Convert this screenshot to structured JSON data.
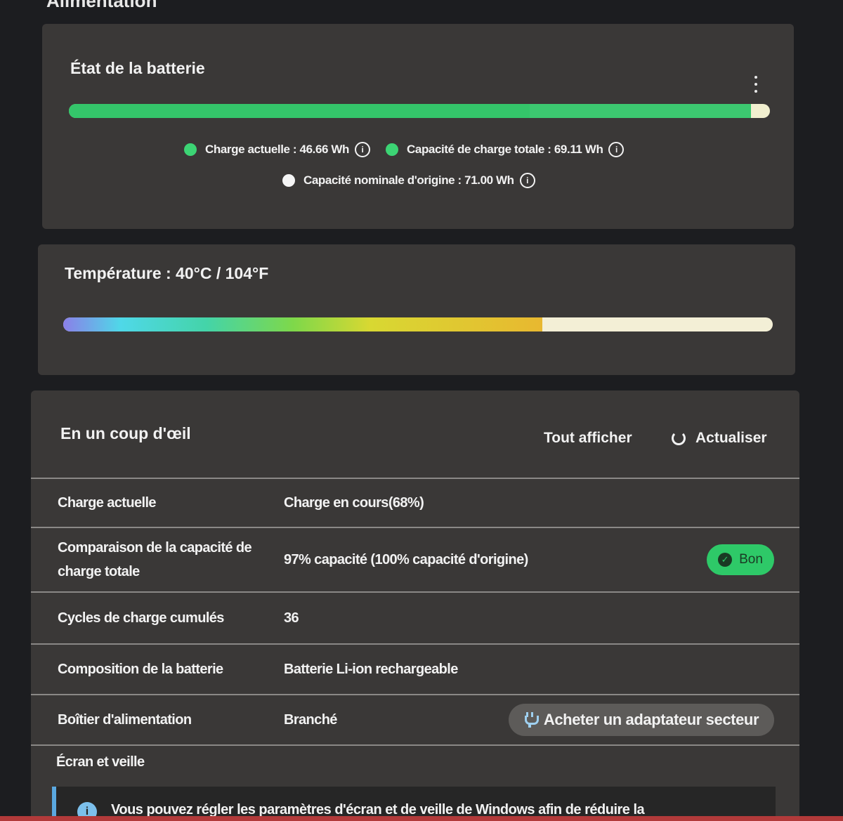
{
  "section_heading": "Alimentation",
  "battery": {
    "title": "État de la batterie",
    "current_charge_wh": 46.66,
    "total_capacity_wh": 69.11,
    "nominal_capacity_wh": 71.0,
    "legend": {
      "current": "Charge actuelle : 46.66 Wh",
      "total": "Capacité de charge totale : 69.11 Wh",
      "nominal": "Capacité nominale d'origine : 71.00 Wh"
    },
    "colors": {
      "current": "#34c56a",
      "total": "#3cc870",
      "nominal": "#f1efcf"
    }
  },
  "temperature": {
    "title": "Température :  40°C / 104°F",
    "level_fraction": 0.675
  },
  "glance": {
    "title": "En un coup d'œil",
    "show_all": "Tout afficher",
    "refresh": "Actualiser",
    "rows": [
      {
        "label": "Charge actuelle",
        "value": "Charge en cours(68%)"
      },
      {
        "label": "Comparaison de la capacité de charge totale",
        "value": "97% capacité (100% capacité d'origine)",
        "badge": "Bon"
      },
      {
        "label": "Cycles de charge cumulés",
        "value": "36"
      },
      {
        "label": "Composition de la batterie",
        "value": "Batterie Li-ion rechargeable"
      },
      {
        "label": "Boîtier d'alimentation",
        "value": "Branché",
        "action": "Acheter un adaptateur secteur"
      }
    ],
    "screen_heading": "Écran et veille",
    "banner_text": "Vous pouvez régler les paramètres d'écran et de veille de Windows afin de réduire la"
  },
  "icons": {
    "menu": "kebab-menu-icon",
    "info": "info-icon",
    "refresh": "refresh-icon",
    "check": "check-circle-icon",
    "plug": "plug-icon"
  }
}
